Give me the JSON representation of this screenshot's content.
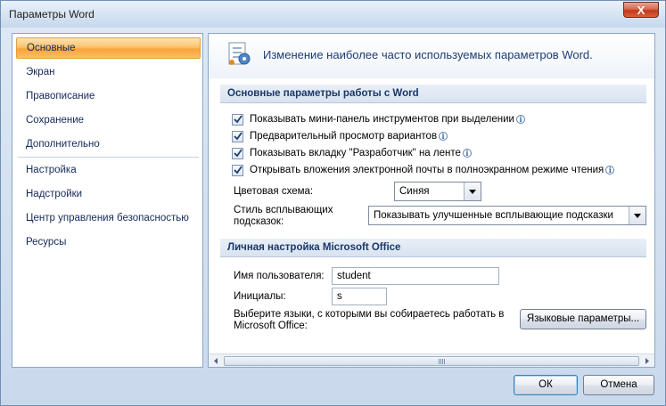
{
  "window": {
    "title": "Параметры Word",
    "close_glyph": "X"
  },
  "sidebar": {
    "items": [
      {
        "label": "Основные",
        "active": true
      },
      {
        "label": "Экран"
      },
      {
        "label": "Правописание"
      },
      {
        "label": "Сохранение"
      },
      {
        "label": "Дополнительно"
      },
      {
        "label": "Настройка"
      },
      {
        "label": "Надстройки"
      },
      {
        "label": "Центр управления безопасностью"
      },
      {
        "label": "Ресурсы"
      }
    ]
  },
  "header": {
    "text": "Изменение наиболее часто используемых параметров Word.",
    "icon": "options-icon"
  },
  "section1": {
    "title": "Основные параметры работы с Word",
    "checkboxes": [
      {
        "label": "Показывать мини-панель инструментов при выделении",
        "checked": true
      },
      {
        "label": "Предварительный просмотр вариантов",
        "checked": true
      },
      {
        "label": "Показывать вкладку \"Разработчик\" на ленте",
        "checked": true
      },
      {
        "label": "Открывать вложения электронной почты в полноэкранном режиме чтения",
        "checked": true
      }
    ],
    "color_scheme_label": "Цветовая схема:",
    "color_scheme_value": "Синяя",
    "tooltip_style_label_line1": "Стиль всплывающих",
    "tooltip_style_label_line2": "подсказок:",
    "tooltip_style_value": "Показывать улучшенные всплывающие подсказки"
  },
  "section2": {
    "title": "Личная настройка Microsoft Office",
    "username_label": "Имя пользователя:",
    "username_value": "student",
    "initials_label": "Инициалы:",
    "initials_value": "s",
    "languages_text_line1": "Выберите языки, с которыми вы собираетесь работать в",
    "languages_text_line2": "Microsoft Office:",
    "languages_button": "Языковые параметры..."
  },
  "footer": {
    "ok": "ОК",
    "cancel": "Отмена"
  },
  "colors": {
    "accent": "#f9a43a",
    "section": "#1b3768",
    "window": "#c9d9ec"
  }
}
